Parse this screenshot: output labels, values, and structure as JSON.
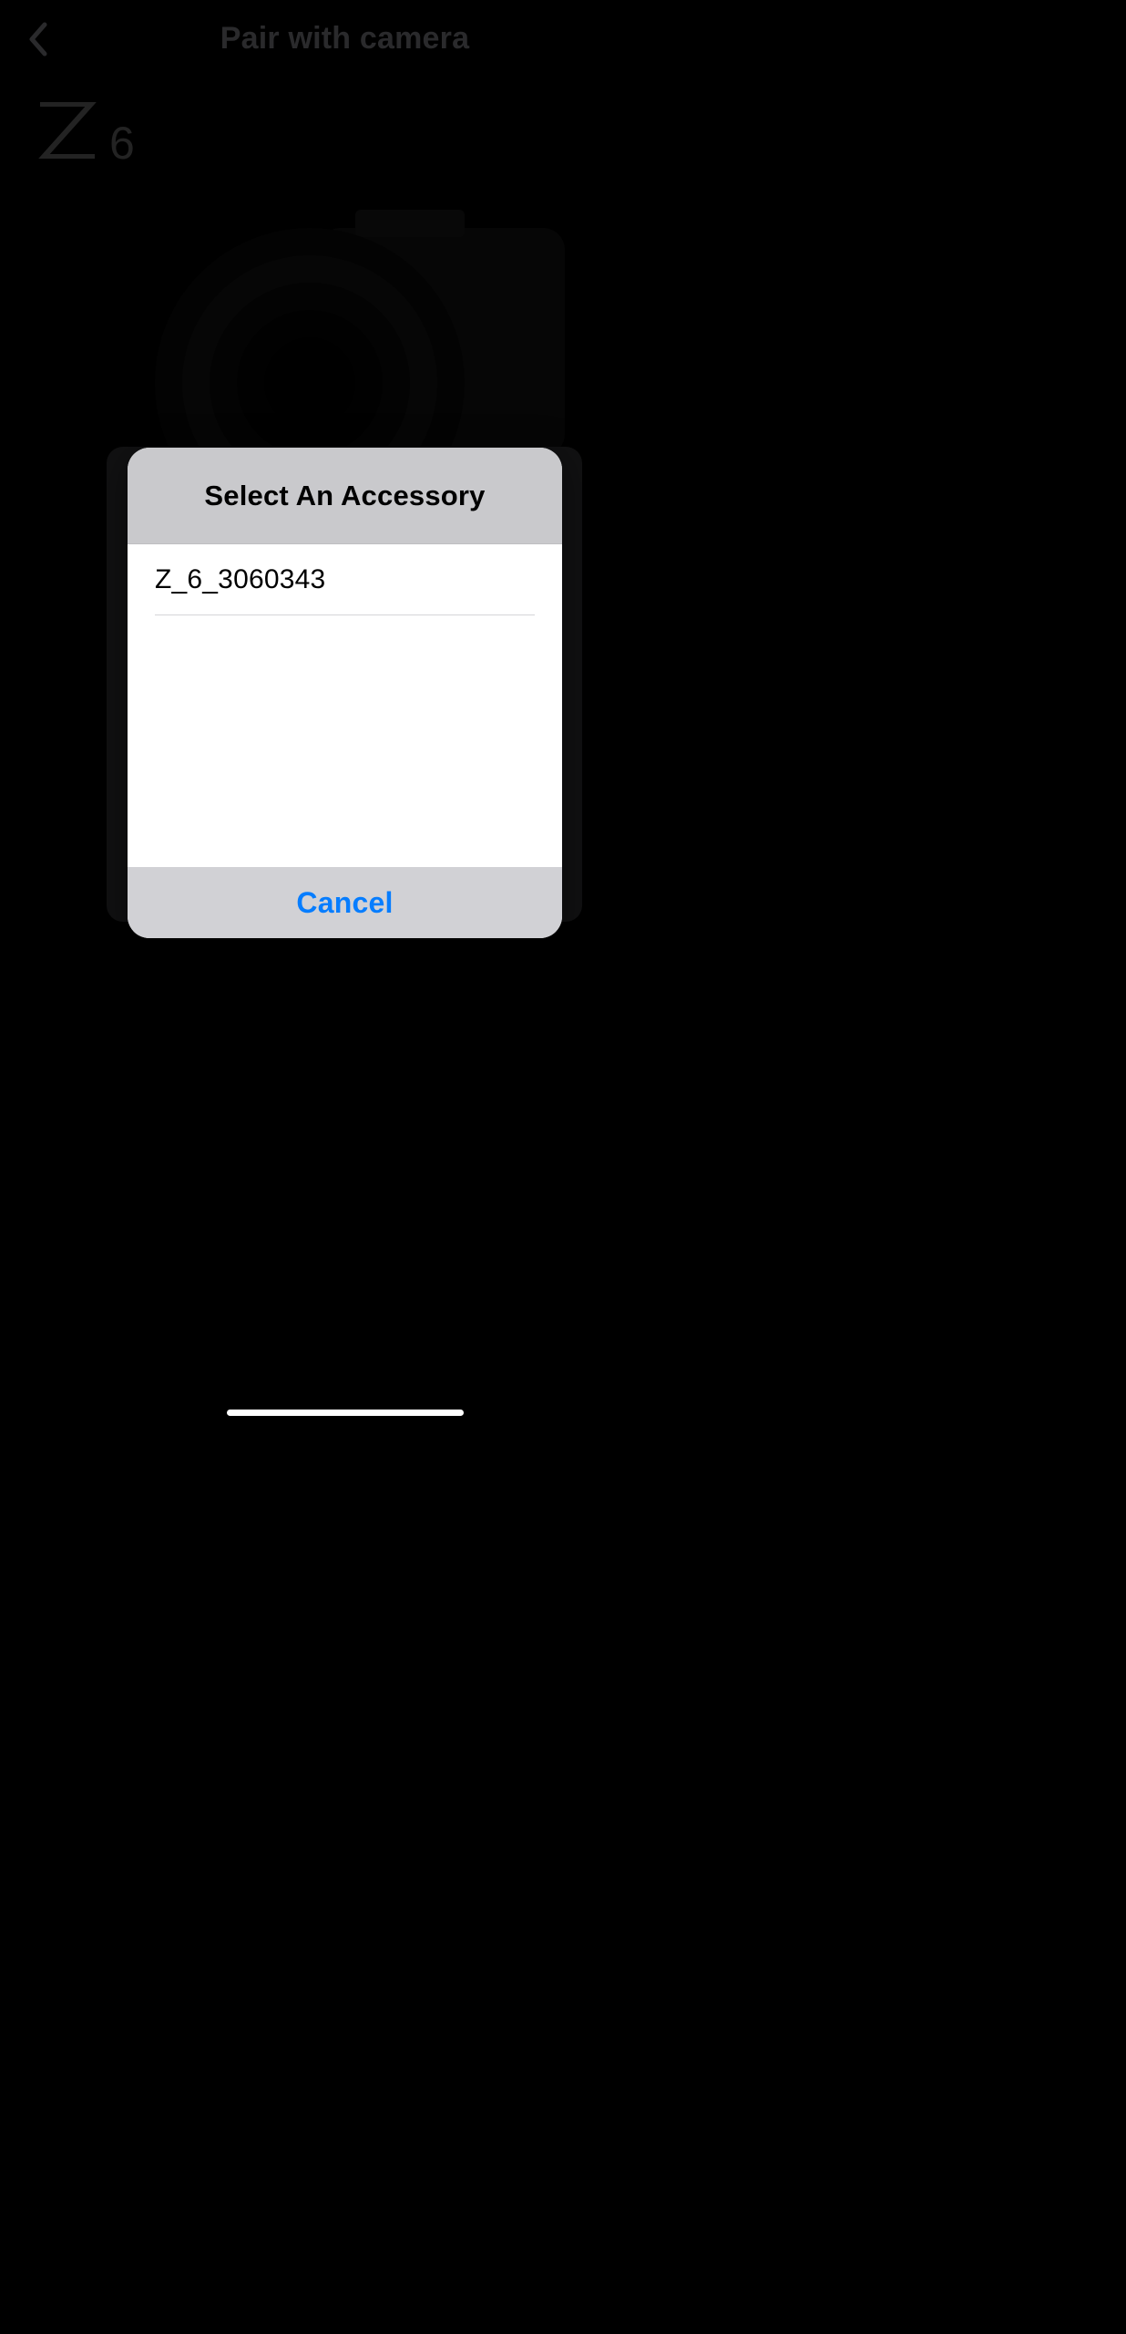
{
  "nav": {
    "title": "Pair with camera"
  },
  "model": {
    "number": "6"
  },
  "modal": {
    "title": "Select An Accessory",
    "accessories": [
      {
        "name": "Z_6_3060343"
      }
    ],
    "cancel_label": "Cancel"
  }
}
